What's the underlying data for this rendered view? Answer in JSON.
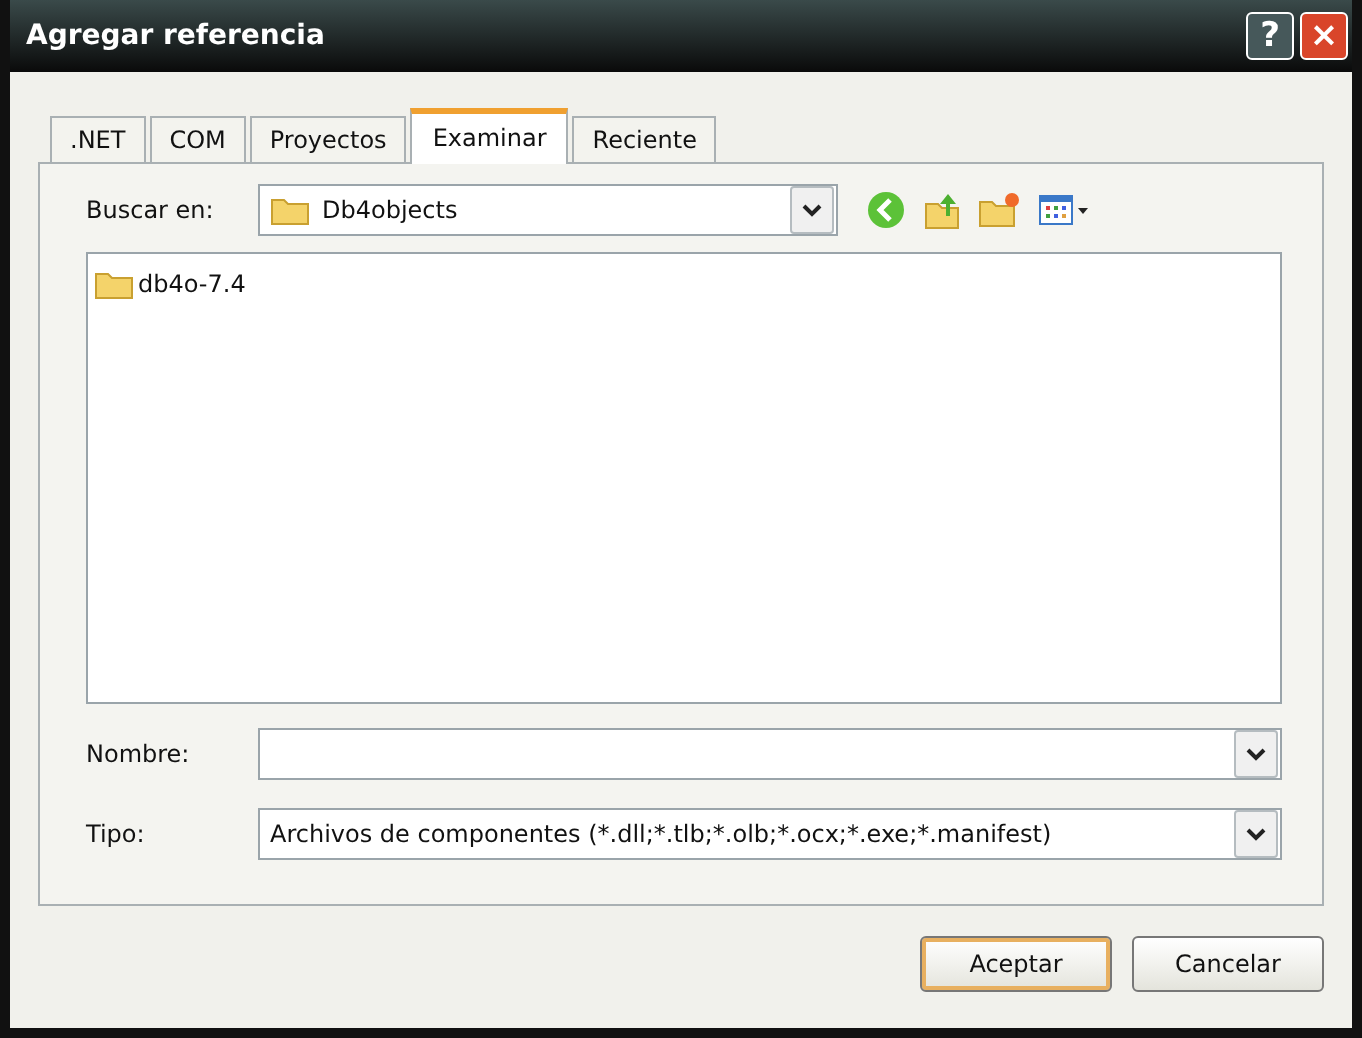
{
  "window": {
    "title": "Agregar referencia",
    "title_buttons": [
      "?",
      "×"
    ]
  },
  "tabs": [
    {
      "label": ".NET",
      "selected": false
    },
    {
      "label": "COM",
      "selected": false
    },
    {
      "label": "Proyectos",
      "selected": false
    },
    {
      "label": "Examinar",
      "selected": true
    },
    {
      "label": "Reciente",
      "selected": false
    }
  ],
  "look_in": {
    "label": "Buscar en:",
    "value": "Db4objects"
  },
  "files": [
    {
      "name": "db4o-7.4",
      "selected": false
    }
  ],
  "file_name": {
    "label": "Nombre:"
  },
  "file_type": {
    "label": "Tipo:",
    "value": "Archivos de componentes (*.dll;*.tlb;*.olb;*.ocx;*.exe;*.manifest)"
  },
  "buttons": [
    {
      "label": "Aceptar",
      "default": true
    },
    {
      "label": "Cancelar",
      "default": false
    }
  ]
}
